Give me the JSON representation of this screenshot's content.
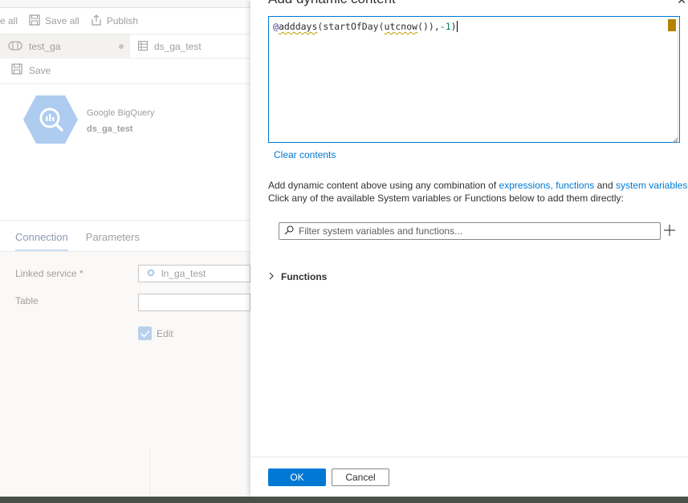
{
  "toolbar": {
    "validate_all_label": "e all",
    "save_all_label": "Save all",
    "publish_label": "Publish"
  },
  "tabs": [
    {
      "label": "test_ga",
      "icon": "pipeline-icon"
    },
    {
      "label": "ds_ga_test",
      "icon": "table-icon"
    }
  ],
  "dataset": {
    "save_label": "Save",
    "type": "Google BigQuery",
    "name": "ds_ga_test",
    "icon": "bigquery-icon"
  },
  "properties": {
    "tabs": [
      "Connection",
      "Parameters"
    ],
    "linked_service_label": "Linked service *",
    "linked_service_value": "ln_ga_test",
    "table_label": "Table",
    "table_value": "",
    "edit_label": "Edit"
  },
  "panel": {
    "title": "Add dynamic content",
    "close_glyph": "✕",
    "expression": {
      "at": "@",
      "fn1": "adddays",
      "p1": "(",
      "fn2": "startOfDay",
      "p2": "(",
      "fn3": "utcnow",
      "p3": "()),",
      "num": "-1",
      "p4": ")"
    },
    "clear_label": "Clear contents",
    "help_line1_prefix": "Add dynamic content above using any combination of ",
    "help_link_expressions": "expressions,",
    "help_link_functions": "functions",
    "help_and": " and ",
    "help_link_system_variables": "system variables",
    "help_line1_suffix": " .",
    "help_line2": "Click any of the available System variables or Functions below to add them directly:",
    "filter_placeholder": "Filter system variables and functions...",
    "functions_label": "Functions",
    "ok_label": "OK",
    "cancel_label": "Cancel"
  },
  "colors": {
    "accent": "#0078d4",
    "warning_marker": "#b58200"
  }
}
